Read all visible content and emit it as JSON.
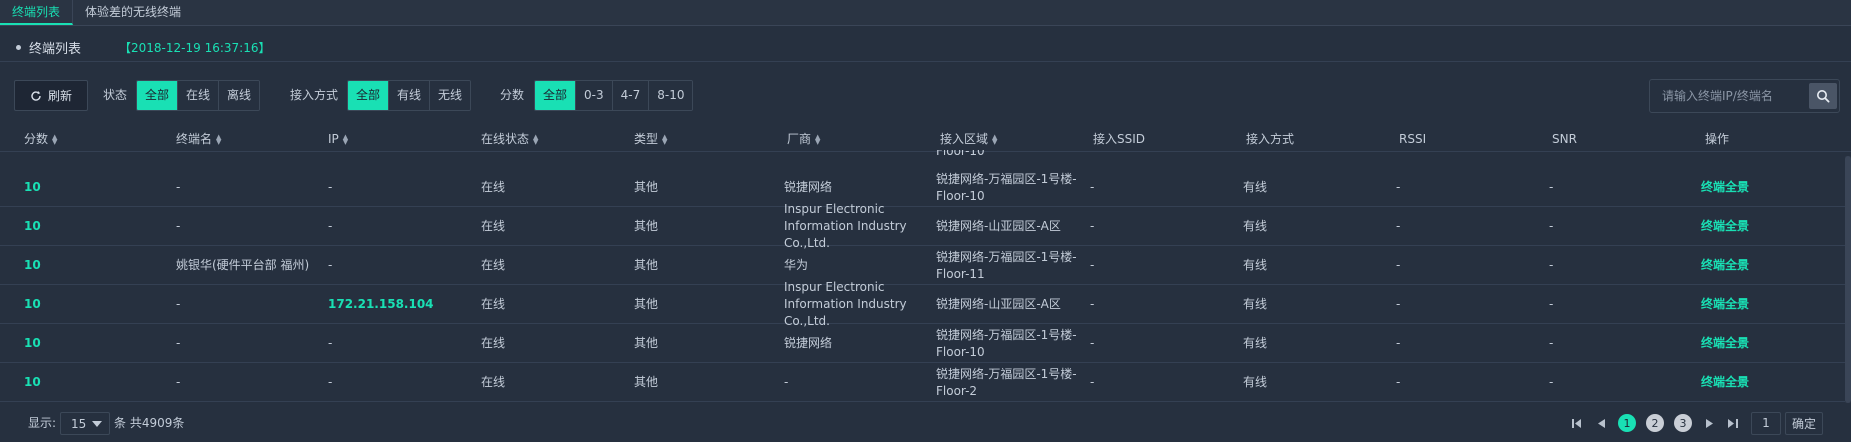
{
  "tabs": [
    {
      "label": "终端列表",
      "active": true
    },
    {
      "label": "体验差的无线终端",
      "active": false
    }
  ],
  "header": {
    "title": "终端列表",
    "timestamp": "【2018-12-19 16:37:16】"
  },
  "filters": {
    "refresh_label": "刷新",
    "status_label": "状态",
    "status_options": [
      "全部",
      "在线",
      "离线"
    ],
    "access_label": "接入方式",
    "access_options": [
      "全部",
      "有线",
      "无线"
    ],
    "score_label": "分数",
    "score_options": [
      "全部",
      "0-3",
      "4-7",
      "8-10"
    ]
  },
  "search": {
    "placeholder": "请输入终端IP/终端名"
  },
  "table": {
    "columns": [
      "分数",
      "终端名",
      "IP",
      "在线状态",
      "类型",
      "厂商",
      "接入区域",
      "接入SSID",
      "接入方式",
      "RSSI",
      "SNR",
      "操作"
    ],
    "partial_top_text": "Floor-10",
    "rows": [
      {
        "score": "10",
        "name": "-",
        "ip": "-",
        "status": "在线",
        "type": "其他",
        "vendor": "锐捷网络",
        "area": "锐捷网络-万福园区-1号楼-Floor-10",
        "ssid": "-",
        "access": "有线",
        "rssi": "-",
        "snr": "-",
        "action": "终端全景"
      },
      {
        "score": "10",
        "name": "-",
        "ip": "-",
        "status": "在线",
        "type": "其他",
        "vendor": "Inspur Electronic Information Industry Co.,Ltd.",
        "area": "锐捷网络-山亚园区-A区",
        "ssid": "-",
        "access": "有线",
        "rssi": "-",
        "snr": "-",
        "action": "终端全景"
      },
      {
        "score": "10",
        "name": "姚银华(硬件平台部 福州)",
        "ip": "-",
        "status": "在线",
        "type": "其他",
        "vendor": "华为",
        "area": "锐捷网络-万福园区-1号楼-Floor-11",
        "ssid": "-",
        "access": "有线",
        "rssi": "-",
        "snr": "-",
        "action": "终端全景"
      },
      {
        "score": "10",
        "name": "-",
        "ip": "172.21.158.104",
        "status": "在线",
        "type": "其他",
        "vendor": "Inspur Electronic Information Industry Co.,Ltd.",
        "area": "锐捷网络-山亚园区-A区",
        "ssid": "-",
        "access": "有线",
        "rssi": "-",
        "snr": "-",
        "action": "终端全景"
      },
      {
        "score": "10",
        "name": "-",
        "ip": "-",
        "status": "在线",
        "type": "其他",
        "vendor": "锐捷网络",
        "area": "锐捷网络-万福园区-1号楼-Floor-10",
        "ssid": "-",
        "access": "有线",
        "rssi": "-",
        "snr": "-",
        "action": "终端全景"
      },
      {
        "score": "10",
        "name": "-",
        "ip": "-",
        "status": "在线",
        "type": "其他",
        "vendor": "-",
        "area": "锐捷网络-万福园区-1号楼-Floor-2",
        "ssid": "-",
        "access": "有线",
        "rssi": "-",
        "snr": "-",
        "action": "终端全景"
      }
    ]
  },
  "footer": {
    "show_label": "显示:",
    "page_size": "15",
    "total_label": "条 共4909条",
    "pages": [
      "1",
      "2",
      "3"
    ],
    "current_page": "1",
    "goto_value": "1",
    "confirm_label": "确定"
  },
  "colors": {
    "accent": "#19e0b4",
    "background": "#26303f"
  }
}
